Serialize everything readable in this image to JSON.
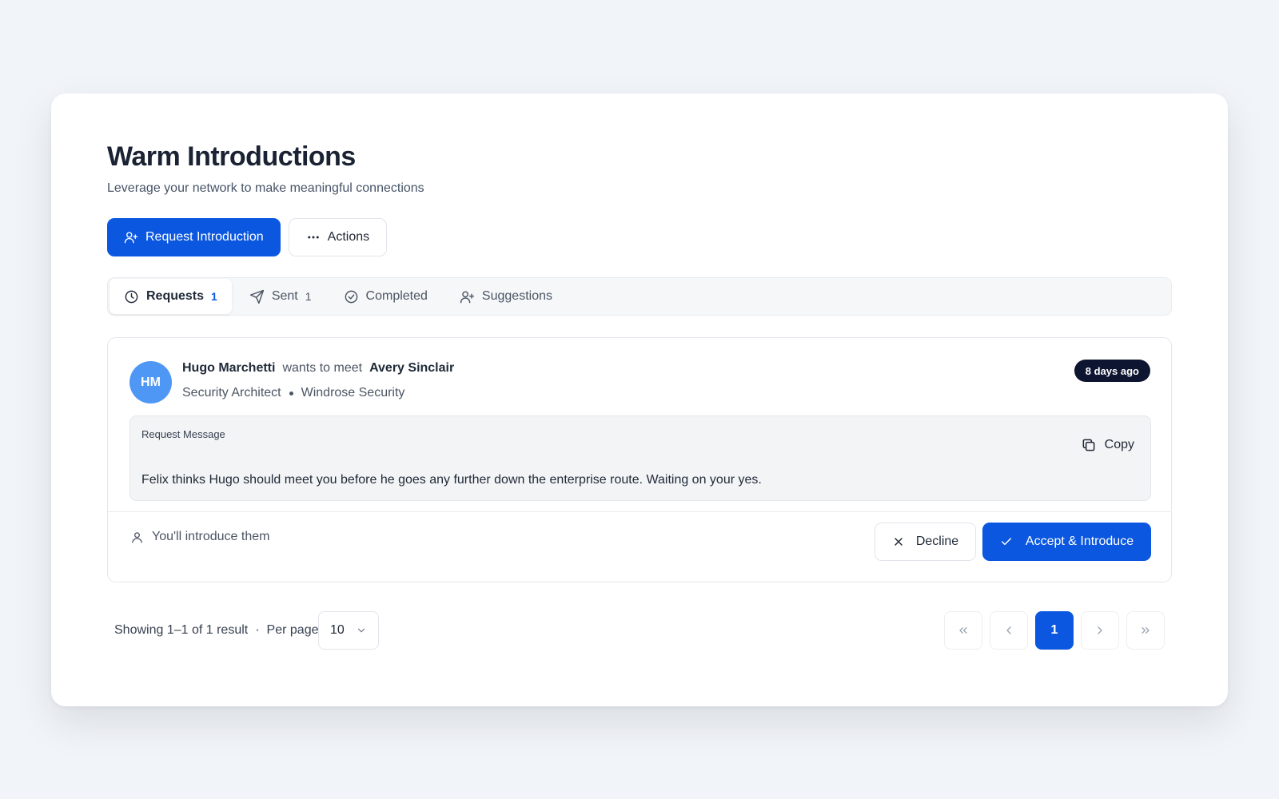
{
  "header": {
    "title": "Warm Introductions",
    "subtitle": "Leverage your network to make meaningful connections"
  },
  "actions": {
    "request_label": "Request Introduction",
    "actions_label": "Actions"
  },
  "tabs": [
    {
      "label": "Requests",
      "count": "1",
      "icon": "clock-icon",
      "active": true
    },
    {
      "label": "Sent",
      "count": "1",
      "icon": "send-icon",
      "active": false
    },
    {
      "label": "Completed",
      "count": "",
      "icon": "check-circle-icon",
      "active": false
    },
    {
      "label": "Suggestions",
      "count": "",
      "icon": "user-plus-icon",
      "active": false
    }
  ],
  "request": {
    "avatar_initials": "HM",
    "requester": "Hugo Marchetti",
    "connector": "wants to meet",
    "target": "Avery Sinclair",
    "role": "Security Architect",
    "company": "Windrose Security",
    "time_ago": "8 days ago",
    "message_label": "Request Message",
    "copy_label": "Copy",
    "message": "Felix thinks Hugo should meet you before he goes any further down the enterprise route. Waiting on your yes.",
    "introduce_note": "You'll introduce them",
    "decline_label": "Decline",
    "accept_label": "Accept & Introduce"
  },
  "pagination": {
    "showing": "Showing 1–1 of 1 result",
    "separator": "·",
    "per_page_label": "Per page",
    "per_page_value": "10",
    "current_page": "1"
  },
  "colors": {
    "accent": "#0b57e0",
    "avatar": "#4f97f5",
    "badge": "#0d1530",
    "background": "#f1f4f8"
  }
}
